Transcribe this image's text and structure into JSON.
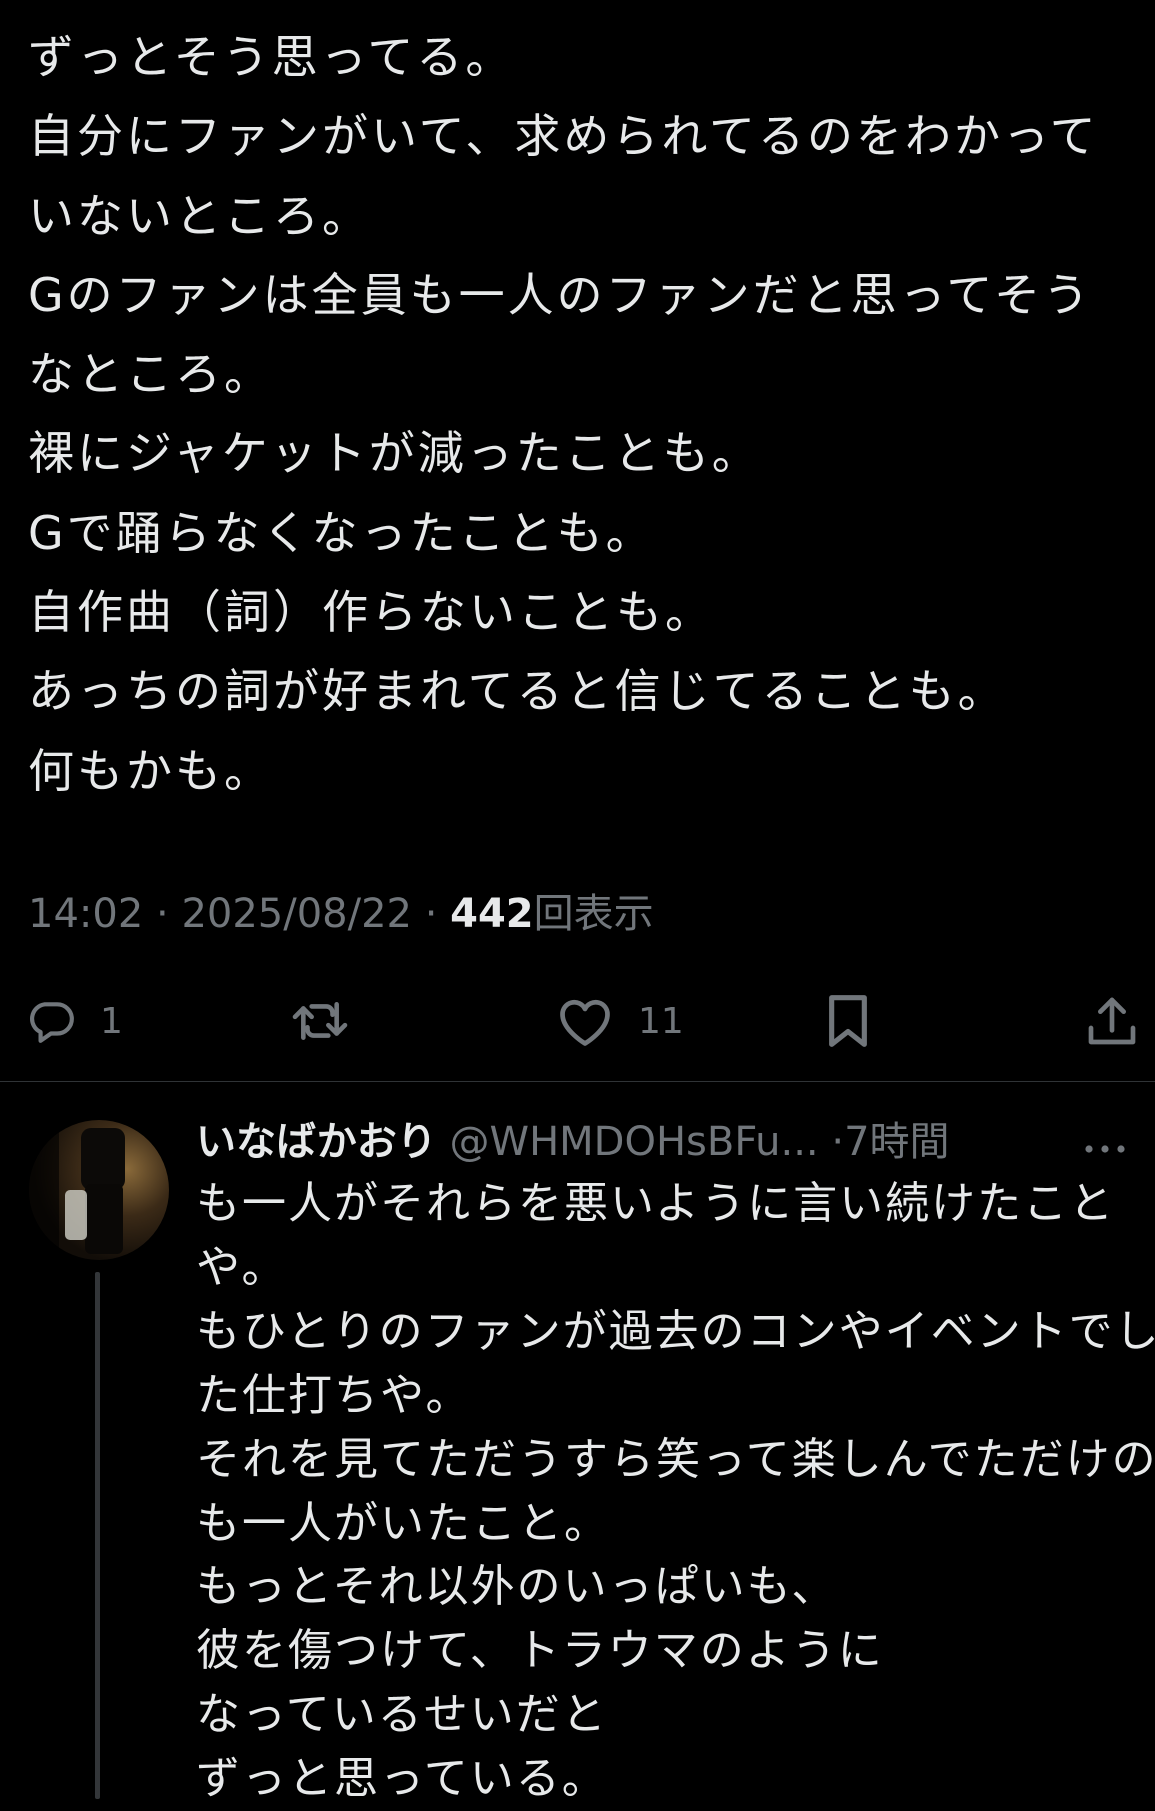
{
  "post": {
    "lines": [
      "ずっとそう思ってる。",
      "自分にファンがいて、求められてるのをわかって",
      "いないところ。",
      "Gのファンは全員も一人のファンだと思ってそう",
      "なところ。",
      "裸にジャケットが減ったことも。",
      "Gで踊らなくなったことも。",
      "自作曲（詞）作らないことも。",
      "あっちの詞が好まれてると信じてることも。",
      "何もかも。"
    ],
    "time": "14:02",
    "date": "2025/08/22",
    "separator": "·",
    "views_count": "442",
    "views_label": "回表示"
  },
  "actions": {
    "reply_icon": "reply-bubble-icon",
    "reply_count": "1",
    "repost_icon": "repost-icon",
    "like_icon": "heart-icon",
    "like_count": "11",
    "bookmark_icon": "bookmark-icon",
    "share_icon": "share-icon"
  },
  "reply": {
    "author_name": "いなばかおり",
    "handle": "@WHMDOHsBFu...",
    "separator": "·",
    "time_ago": "7時間",
    "more_icon": "more-dots-icon",
    "lines": [
      "も一人がそれらを悪いように言い続けたこと",
      "や。",
      "もひとりのファンが過去のコンやイベントでし",
      "た仕打ちや。",
      "それを見てただうすら笑って楽しんでただけの",
      "も一人がいたこと。",
      "もっとそれ以外のいっぱいも、",
      "彼を傷つけて、トラウマのように",
      "なっているせいだと",
      "ずっと思っている。"
    ]
  },
  "colors": {
    "background": "#000000",
    "text": "#e7e9ea",
    "muted": "#71767b",
    "divider": "#2f3336"
  }
}
